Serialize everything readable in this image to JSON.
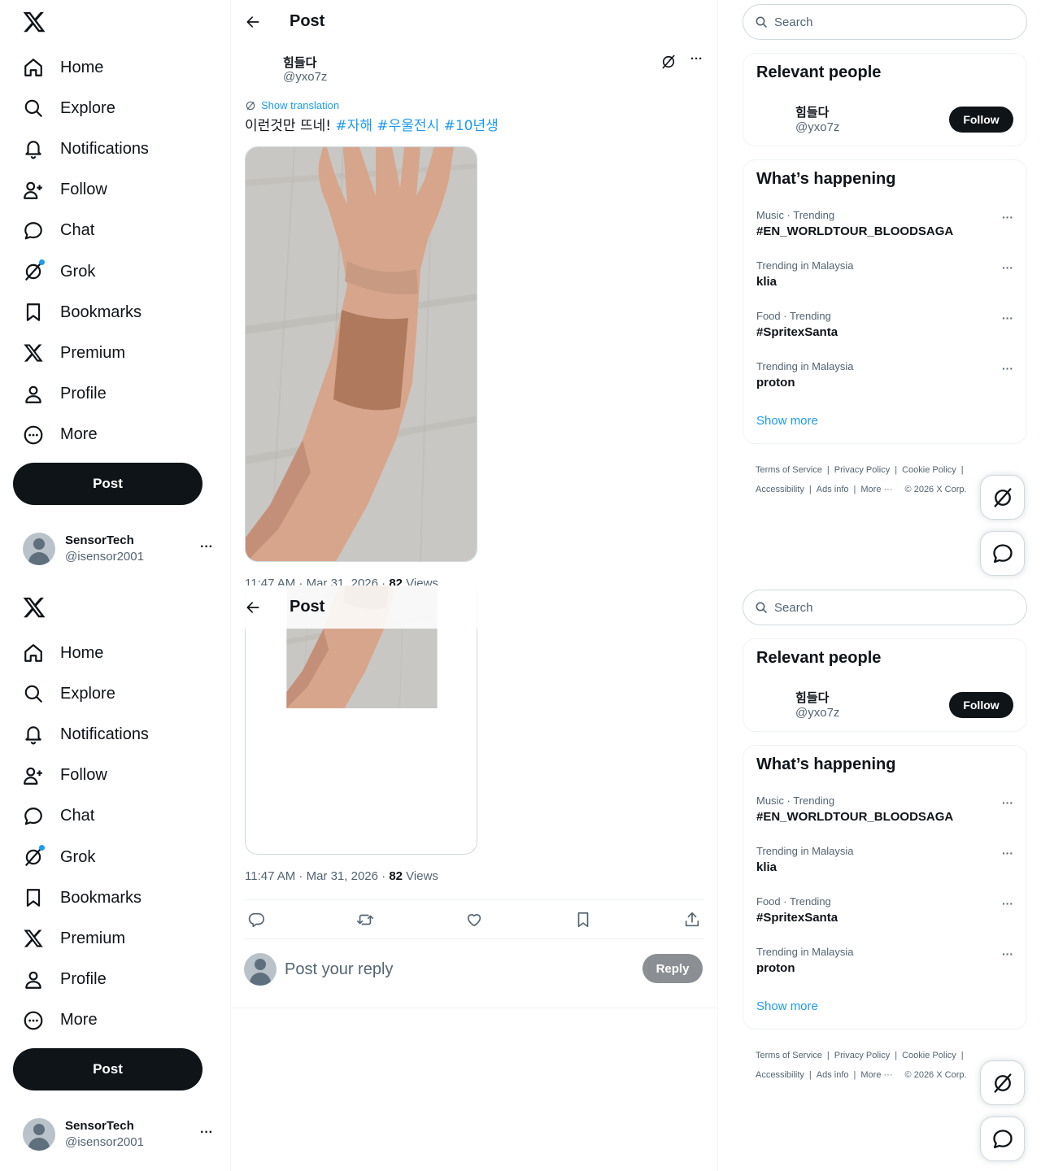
{
  "nav": {
    "items": [
      {
        "label": "Home",
        "icon": "home-icon"
      },
      {
        "label": "Explore",
        "icon": "search-icon"
      },
      {
        "label": "Notifications",
        "icon": "bell-icon"
      },
      {
        "label": "Follow",
        "icon": "person-plus-icon"
      },
      {
        "label": "Chat",
        "icon": "chat-bubble-icon"
      },
      {
        "label": "Grok",
        "icon": "grok-icon"
      },
      {
        "label": "Bookmarks",
        "icon": "bookmark-icon"
      },
      {
        "label": "Premium",
        "icon": "x-logo-icon"
      },
      {
        "label": "Profile",
        "icon": "person-icon"
      },
      {
        "label": "More",
        "icon": "more-circle-icon"
      }
    ],
    "post_button": "Post",
    "account": {
      "name": "SensorTech",
      "handle": "@isensor2001",
      "more": "···"
    }
  },
  "header": {
    "title": "Post"
  },
  "post": {
    "author_name": "힘들다",
    "author_handle": "@yxo7z",
    "more": "···",
    "show_translation": "Show translation",
    "text": "이런것만 뜨네!",
    "hashtags": [
      "#자해",
      "#우울전시",
      "#10년생"
    ],
    "timestamp": "11:47 AM · Mar 31, 2026 · ",
    "views_count": "82",
    "views_label": " Views"
  },
  "reply": {
    "placeholder": "Post your reply",
    "button": "Reply"
  },
  "sidebar": {
    "search_placeholder": "Search",
    "relevant_title": "Relevant people",
    "person": {
      "name": "힘들다",
      "handle": "@yxo7z",
      "follow": "Follow"
    },
    "trends_title": "What’s happening",
    "trends": [
      {
        "context": "Music · Trending",
        "title": "#EN_WORLDTOUR_BLOODSAGA"
      },
      {
        "context": "Trending in Malaysia",
        "title": "klia"
      },
      {
        "context": "Food · Trending",
        "title": "#SpritexSanta"
      },
      {
        "context": "Trending in Malaysia",
        "title": "proton"
      }
    ],
    "trend_more": "···",
    "show_more": "Show more",
    "footer": {
      "terms": "Terms of Service",
      "privacy": "Privacy Policy",
      "cookie": "Cookie Policy",
      "accessibility": "Accessibility",
      "ads": "Ads info",
      "more": "More ···",
      "copyright": "© 2026 X Corp."
    }
  },
  "colors": {
    "accent": "#1d9bf0",
    "text": "#0f1419",
    "secondary": "#536471",
    "border": "#eff3f4",
    "button_dark": "#0f1419"
  }
}
